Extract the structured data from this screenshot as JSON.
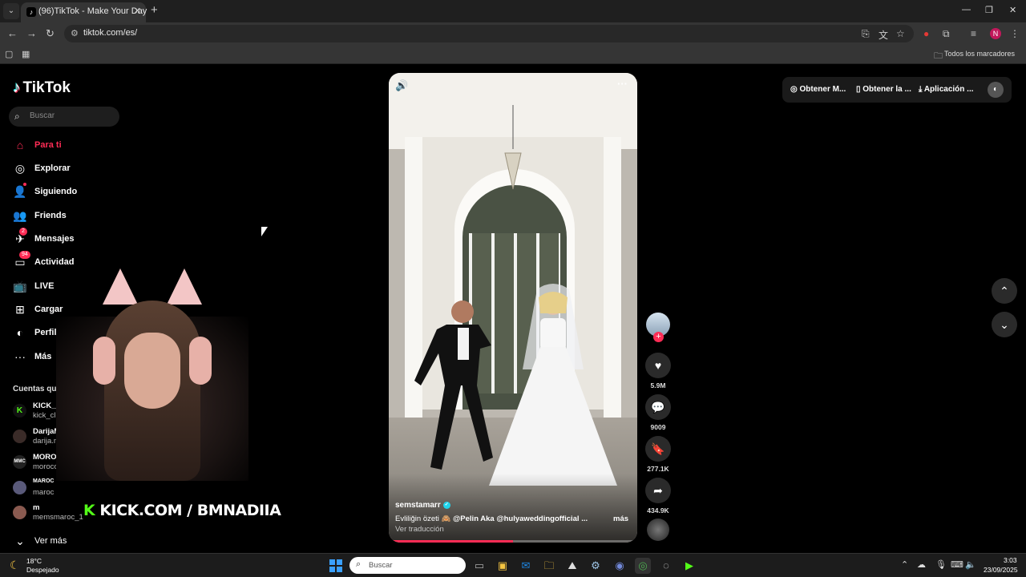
{
  "browser": {
    "tab_title": "(96)TikTok - Make Your Day",
    "url": "tiktok.com/es/",
    "profile_initial": "N",
    "bookmarks_all": "Todos los marcadores"
  },
  "sidebar": {
    "logo": "TikTok",
    "search_placeholder": "Buscar",
    "items": [
      {
        "label": "Para ti",
        "icon": "home-icon"
      },
      {
        "label": "Explorar",
        "icon": "compass-icon"
      },
      {
        "label": "Siguiendo",
        "icon": "following-icon"
      },
      {
        "label": "Friends",
        "icon": "friends-icon"
      },
      {
        "label": "Mensajes",
        "icon": "messages-icon",
        "badge": "2"
      },
      {
        "label": "Actividad",
        "icon": "activity-icon",
        "badge": "94"
      },
      {
        "label": "LIVE",
        "icon": "live-icon"
      },
      {
        "label": "Cargar",
        "icon": "upload-icon"
      },
      {
        "label": "Perfil",
        "icon": "profile-icon"
      },
      {
        "label": "Más",
        "icon": "more-icon"
      }
    ],
    "following_title": "Cuentas que sigues",
    "accounts": [
      {
        "name": "KICK__CLIP",
        "handle": "kick_clip1k"
      },
      {
        "name": "DarijaMA",
        "handle": "darija.maa"
      },
      {
        "name": "MOROCCAN M",
        "handle": "moroccan"
      },
      {
        "name": "MAROC",
        "handle": "maroc"
      },
      {
        "name": "m",
        "handle": "memsmaroc_1"
      }
    ],
    "see_more": "Ver más"
  },
  "overlay": {
    "kick_banner_k": "K",
    "kick_banner": "KICK.COM / BMNADIIA"
  },
  "video": {
    "author": "semstamarr",
    "caption_text": "Evliliğin özeti 🙈",
    "caption_mentions": "@Pelin Aka  @hulyaweddingofficial ...",
    "more": "más",
    "translate": "Ver traducción",
    "progress": 0.5
  },
  "actions": {
    "likes": "5.9M",
    "comments": "9009",
    "saves": "277.1K",
    "shares": "434.9K"
  },
  "top_actions": {
    "coins": "Obtener M...",
    "app": "Obtener la ...",
    "download": "Aplicación ..."
  },
  "taskbar": {
    "temp": "18°C",
    "weather": "Despejado",
    "search_placeholder": "Buscar",
    "time": "3:03",
    "date": "23/09/2025"
  }
}
